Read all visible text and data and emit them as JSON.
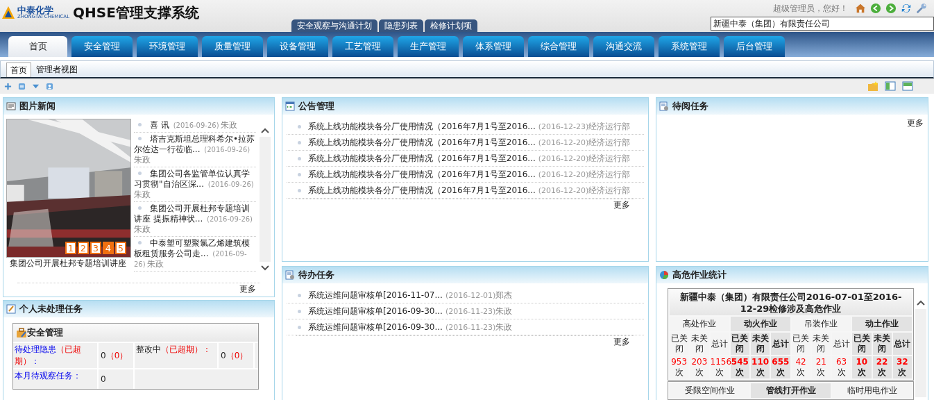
{
  "header": {
    "logo_text": "中泰化学",
    "logo_subtext": "ZHONGTAI CHEMICAL",
    "system_title": "QHSE管理支撑系统",
    "greeting": "超级管理员，您好！",
    "company_select": {
      "value": "新疆中泰（集团）有限责任公司"
    }
  },
  "quick_tabs": [
    {
      "label": "安全观察与沟通计划"
    },
    {
      "label": "隐患列表"
    },
    {
      "label": "检修计划项"
    }
  ],
  "nav_tabs": [
    {
      "label": "首页",
      "selected": true
    },
    {
      "label": "安全管理",
      "selected": false
    },
    {
      "label": "环境管理",
      "selected": false
    },
    {
      "label": "质量管理",
      "selected": false
    },
    {
      "label": "设备管理",
      "selected": false
    },
    {
      "label": "工艺管理",
      "selected": false
    },
    {
      "label": "生产管理",
      "selected": false
    },
    {
      "label": "体系管理",
      "selected": false
    },
    {
      "label": "综合管理",
      "selected": false
    },
    {
      "label": "沟通交流",
      "selected": false
    },
    {
      "label": "系统管理",
      "selected": false
    },
    {
      "label": "后台管理",
      "selected": false
    }
  ],
  "sub_tabs": [
    {
      "label": "首页",
      "selected": true
    },
    {
      "label": "管理者视图",
      "selected": false
    }
  ],
  "photo_news": {
    "title": "图片新闻",
    "slides": [
      {
        "label": "1",
        "selected": false
      },
      {
        "label": "2",
        "selected": false
      },
      {
        "label": "3",
        "selected": false
      },
      {
        "label": "4",
        "selected": true
      },
      {
        "label": "5",
        "selected": false
      }
    ],
    "caption": "集团公司开展杜邦专题培训讲座",
    "items": [
      {
        "title": "喜 讯",
        "date": "(2016-09-26)",
        "author": "朱政"
      },
      {
        "title": "塔吉克斯坦总理科希尔•拉苏尔佐达一行莅临...",
        "date": "(2016-09-26)",
        "author": "朱政"
      },
      {
        "title": "集团公司各监管单位认真学习贯彻\"自治区深...",
        "date": "(2016-09-26)",
        "author": "朱政"
      },
      {
        "title": "集团公司开展杜邦专题培训讲座  提振精神状...",
        "date": "(2016-09-26)",
        "author": "朱政"
      },
      {
        "title": "中泰塑可塑聚氯乙烯建筑模板租赁服务公司走...",
        "date": "(2016-09-26)",
        "author": "朱政"
      }
    ],
    "more": "更多"
  },
  "personal_tasks": {
    "title": "个人未处理任务",
    "section": "安全管理",
    "rows": [
      {
        "items": [
          {
            "label": "待处理隐患",
            "note": "（已超期）",
            "suffix": "：",
            "kind": "link",
            "count": "0",
            "overdue_count": "（0）"
          },
          {
            "label": "整改中",
            "note": "（已超期）：",
            "kind": "plain",
            "count": "0",
            "overdue_count": "（0）"
          }
        ]
      },
      {
        "items": [
          {
            "label": "本月待观察任务：",
            "kind": "link",
            "count": "0"
          }
        ]
      }
    ]
  },
  "notices": {
    "title": "公告管理",
    "items": [
      {
        "title": "系统上线功能模块各分厂使用情况（2016年7月1号至2016...",
        "date": "(2016-12-23)",
        "dept": "经济运行部"
      },
      {
        "title": "系统上线功能模块各分厂使用情况（2016年7月1号至2016...",
        "date": "(2016-12-20)",
        "dept": "经济运行部"
      },
      {
        "title": "系统上线功能模块各分厂使用情况（2016年7月1号至2016...",
        "date": "(2016-12-20)",
        "dept": "经济运行部"
      },
      {
        "title": "系统上线功能模块各分厂使用情况（2016年7月1号至2016...",
        "date": "(2016-12-20)",
        "dept": "经济运行部"
      },
      {
        "title": "系统上线功能模块各分厂使用情况（2016年7月1号至2016...",
        "date": "(2016-12-20)",
        "dept": "经济运行部"
      }
    ],
    "more": "更多"
  },
  "todo": {
    "title": "待办任务",
    "items": [
      {
        "title": "系统运维问题审核单[2016-11-07...",
        "date": "(2016-12-01)",
        "dept": "郑杰"
      },
      {
        "title": "系统运维问题审核单[2016-09-30...",
        "date": "(2016-11-23)",
        "dept": "朱政"
      },
      {
        "title": "系统运维问题审核单[2016-09-30...",
        "date": "(2016-11-23)",
        "dept": "朱政"
      }
    ],
    "more": "更多"
  },
  "pending_read": {
    "title": "待阅任务",
    "more": "更多"
  },
  "high_risk": {
    "title": "高危作业统计",
    "table_title": "新疆中泰（集团）有限责任公司2016-07-01至2016-12-29检修涉及高危作业",
    "groups": [
      {
        "name": "高处作业",
        "emphasized": false,
        "cells": [
          {
            "label": "已关闭",
            "value": "953",
            "unit": "次"
          },
          {
            "label": "未关闭",
            "value": "203",
            "unit": "次"
          },
          {
            "label": "总计",
            "value": "1156",
            "unit": "次"
          }
        ]
      },
      {
        "name": "动火作业",
        "emphasized": true,
        "cells": [
          {
            "label": "已关闭",
            "value": "545",
            "unit": "次"
          },
          {
            "label": "未关闭",
            "value": "110",
            "unit": "次"
          },
          {
            "label": "总计",
            "value": "655",
            "unit": "次"
          }
        ]
      },
      {
        "name": "吊装作业",
        "emphasized": false,
        "cells": [
          {
            "label": "已关闭",
            "value": "42",
            "unit": "次"
          },
          {
            "label": "未关闭",
            "value": "21",
            "unit": "次"
          },
          {
            "label": "总计",
            "value": "63",
            "unit": "次"
          }
        ]
      },
      {
        "name": "动土作业",
        "emphasized": true,
        "cells": [
          {
            "label": "已关闭",
            "value": "10",
            "unit": "次"
          },
          {
            "label": "未关闭",
            "value": "22",
            "unit": "次"
          },
          {
            "label": "总计",
            "value": "32",
            "unit": "次"
          }
        ]
      }
    ],
    "next_groups": [
      {
        "name": "受限空间作业",
        "emphasized": false
      },
      {
        "name": "管线打开作业",
        "emphasized": true
      },
      {
        "name": "临时用电作业",
        "emphasized": false
      }
    ]
  }
}
